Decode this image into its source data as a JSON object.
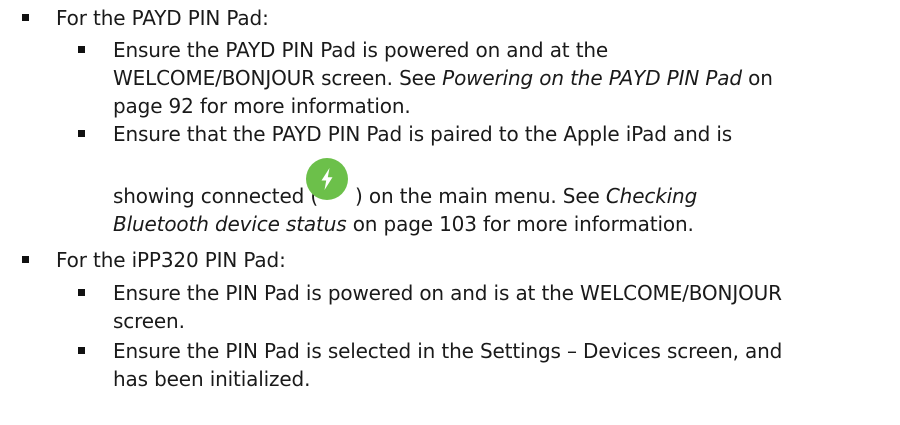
{
  "doc": {
    "payd_heading": "For the PAYD PIN Pad:",
    "payd_item1": {
      "line1": "Ensure the PAYD PIN Pad is powered on and at the",
      "line2_pre": "WELCOME/BONJOUR screen. See ",
      "line2_ref": "Powering on the PAYD PIN Pad",
      "line2_post": " on",
      "line3": "page 92 for more information."
    },
    "payd_item2": {
      "line1": "Ensure that the PAYD PIN Pad is paired to the Apple iPad and is",
      "line2_pre": "showing connected (",
      "icon": "connected-bolt-icon",
      "icon_color": "#6cc04a",
      "line2_post": ") on the main menu. See ",
      "line2_ref": "Checking",
      "line3_ref": "Bluetooth device status",
      "line3_post": " on page 103 for more information."
    },
    "ipp_heading": "For the iPP320 PIN Pad:",
    "ipp_item1": {
      "line1": "Ensure the PIN Pad is powered on and is at the WELCOME/BONJOUR",
      "line2": "screen."
    },
    "ipp_item2": {
      "line1": "Ensure the PIN Pad is selected in the Settings – Devices screen, and",
      "line2": "has been initialized."
    }
  }
}
